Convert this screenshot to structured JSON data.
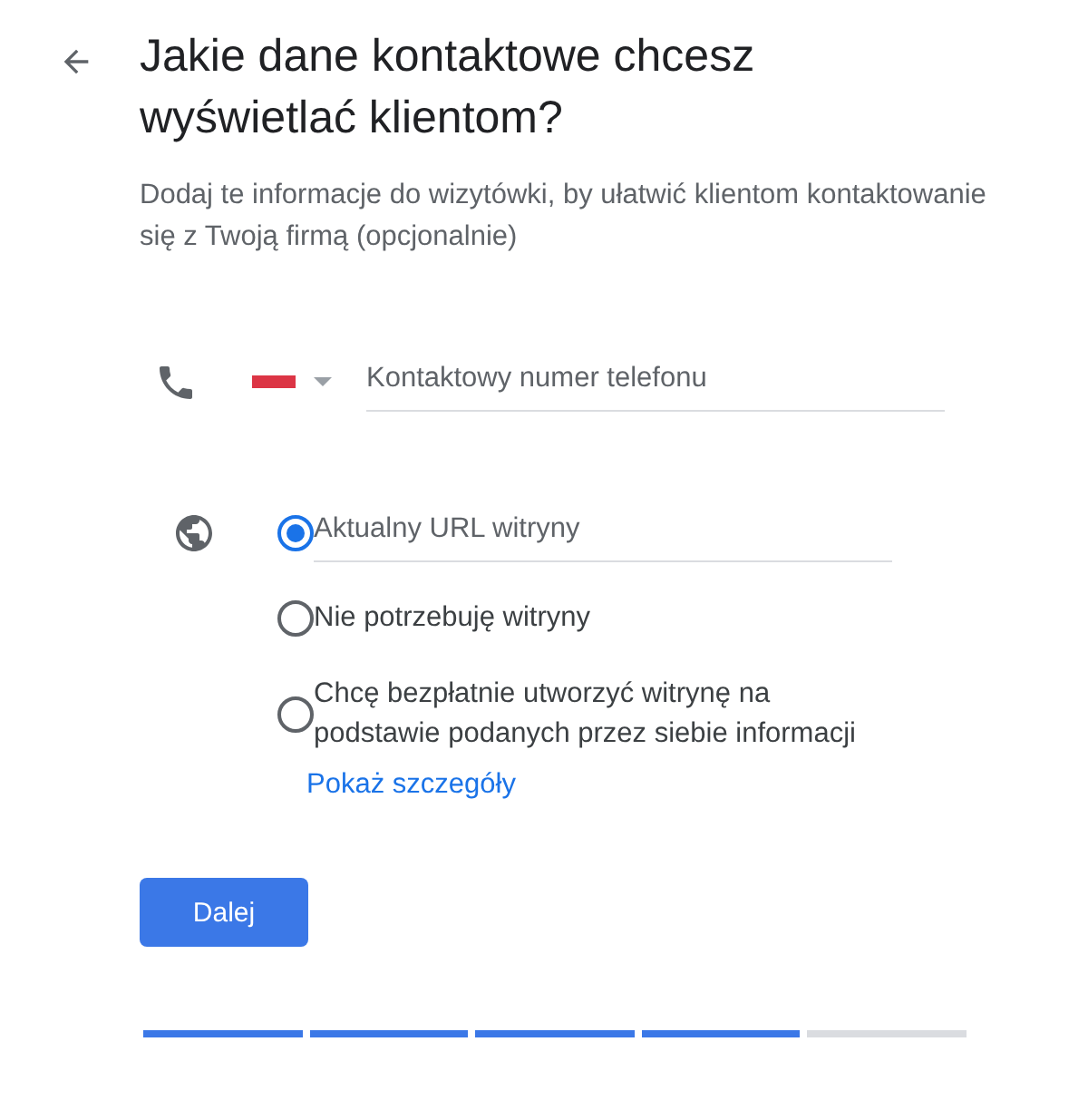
{
  "title": "Jakie dane kontaktowe chcesz wyświetlać klientom?",
  "subtitle": "Dodaj te informacje do wizytówki, by ułatwić klientom kontaktowanie się z Twoją firmą (opcjonalnie)",
  "phone": {
    "placeholder": "Kontaktowy numer telefonu"
  },
  "website_options": [
    {
      "kind": "field",
      "placeholder": "Aktualny URL witryny",
      "selected": true
    },
    {
      "kind": "text",
      "label": "Nie potrzebuję witryny",
      "selected": false
    },
    {
      "kind": "text",
      "label": "Chcę bezpłatnie utworzyć witrynę na podstawie podanych przez siebie informacji",
      "link": "Pokaż szczegóły",
      "selected": false
    }
  ],
  "next_button": "Dalej",
  "progress": [
    {
      "done": true
    },
    {
      "done": true
    },
    {
      "done": true
    },
    {
      "done": true
    },
    {
      "done": false
    }
  ]
}
